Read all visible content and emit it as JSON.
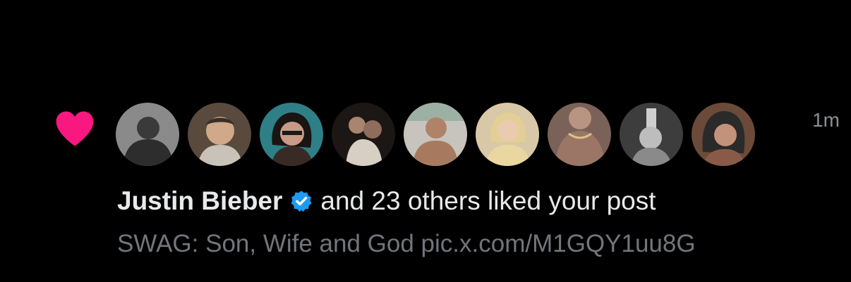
{
  "notification": {
    "type_icon": "heart-icon",
    "heart_color": "#f91880",
    "timestamp": "1m",
    "user_name": "Justin Bieber",
    "verified_icon": "verified-badge-icon",
    "verified_color": "#1d9bf0",
    "action_text": "and 23 others liked your post",
    "post_preview": "SWAG: Son, Wife and God pic.x.com/M1GQY1uu8G",
    "avatars": [
      {
        "name": "avatar-1",
        "bg": "#8a8a8a",
        "fg": "#3a3a3a"
      },
      {
        "name": "avatar-2",
        "bg": "#5a4a3e",
        "fg": "#cfa98a"
      },
      {
        "name": "avatar-3",
        "bg": "#2f7f86",
        "fg": "#c99a86"
      },
      {
        "name": "avatar-4",
        "bg": "#1c1714",
        "fg": "#a98470"
      },
      {
        "name": "avatar-5",
        "bg": "#c7c4bd",
        "fg": "#b08268"
      },
      {
        "name": "avatar-6",
        "bg": "#d9c8a7",
        "fg": "#e9d6a0"
      },
      {
        "name": "avatar-7",
        "bg": "#7a6258",
        "fg": "#b89482"
      },
      {
        "name": "avatar-8",
        "bg": "#3d3d3d",
        "fg": "#bdbdbd"
      },
      {
        "name": "avatar-9",
        "bg": "#6b4a3a",
        "fg": "#2a2a2a"
      }
    ]
  }
}
